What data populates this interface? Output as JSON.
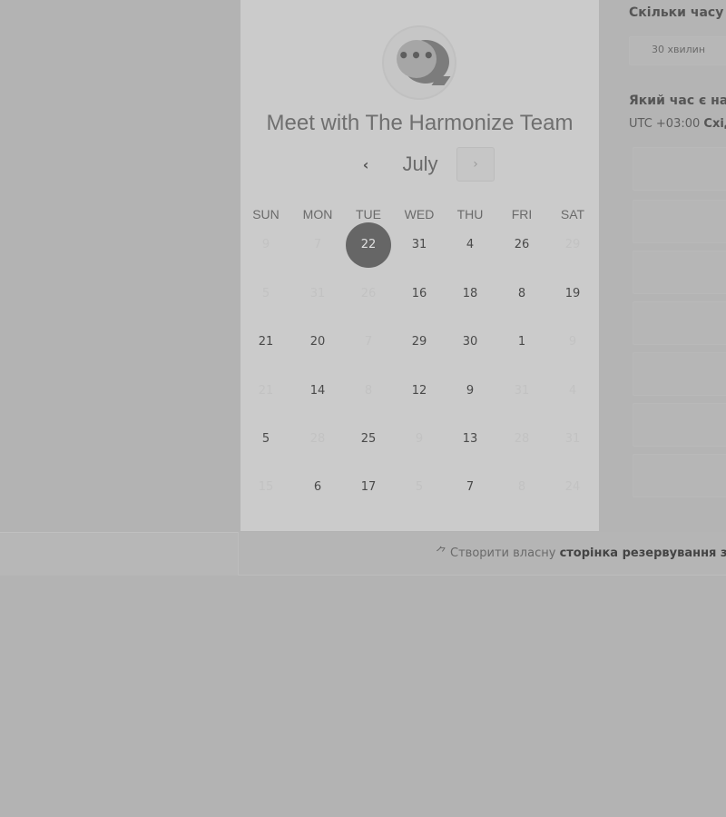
{
  "calendar": {
    "title": "Meet with The Harmonize Team",
    "month": "July",
    "prev_icon": "‹",
    "next_icon": "›",
    "weekdays": [
      "SUN",
      "MON",
      "TUE",
      "WED",
      "THU",
      "FRI",
      "SAT"
    ],
    "weeks": [
      [
        "9",
        "7",
        "22",
        "31",
        "4",
        "26",
        "29"
      ],
      [
        "5",
        "31",
        "26",
        "16",
        "18",
        "8",
        "19"
      ],
      [
        "21",
        "20",
        "7",
        "29",
        "30",
        "1",
        "9"
      ],
      [
        "21",
        "14",
        "8",
        "12",
        "9",
        "31",
        "4"
      ],
      [
        "5",
        "28",
        "25",
        "9",
        "13",
        "28",
        "31"
      ],
      [
        "15",
        "6",
        "17",
        "5",
        "7",
        "8",
        "24"
      ]
    ],
    "selected_day": "22"
  },
  "duration": {
    "question": "Скільки часу",
    "selected": "30 хвилин"
  },
  "timeslots": {
    "question": "Який час є на",
    "timezone_prefix": "UTC +03:00",
    "timezone_name": "Схід"
  },
  "footer": {
    "icon": "sprout-icon",
    "text_prefix": "Створити власну",
    "text_bold": "сторінка резервування зуст"
  },
  "colors": {
    "overlay": "#b3b3b3",
    "selected_day_bg": "#666666"
  }
}
